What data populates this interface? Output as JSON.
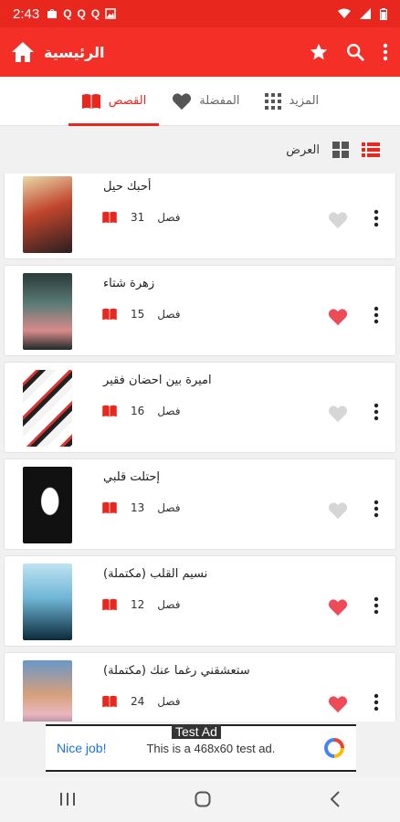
{
  "status": {
    "time": "2:43",
    "notif_q": "Q"
  },
  "appbar": {
    "title": "الرئيسية"
  },
  "tabs": [
    {
      "label": "القصص"
    },
    {
      "label": "المفضلة"
    },
    {
      "label": "المزيد"
    }
  ],
  "view": {
    "label": "العرض"
  },
  "stories": [
    {
      "title": "أحبك حيل",
      "chapters": "31",
      "chapter_label": "فصل",
      "favorite": false
    },
    {
      "title": "زهرة شتاء",
      "chapters": "15",
      "chapter_label": "فصل",
      "favorite": true
    },
    {
      "title": "اميرة بين احضان فقير",
      "chapters": "16",
      "chapter_label": "فصل",
      "favorite": false
    },
    {
      "title": "إحتلت قلبي",
      "chapters": "13",
      "chapter_label": "فصل",
      "favorite": false
    },
    {
      "title": "نسيم القلب (مكتملة)",
      "chapters": "12",
      "chapter_label": "فصل",
      "favorite": true
    },
    {
      "title": "ستعشقني رغما عنك (مكتملة)",
      "chapters": "24",
      "chapter_label": "فصل",
      "favorite": true
    }
  ],
  "ad": {
    "label": "Test Ad",
    "nice": "Nice job!",
    "text": "This is a 468x60 test ad."
  },
  "colors": {
    "primary": "#f42f27",
    "status": "#e8281f",
    "accent": "#e8281f",
    "heart_on": "#ee4a57",
    "heart_off": "#d6d6d6"
  }
}
